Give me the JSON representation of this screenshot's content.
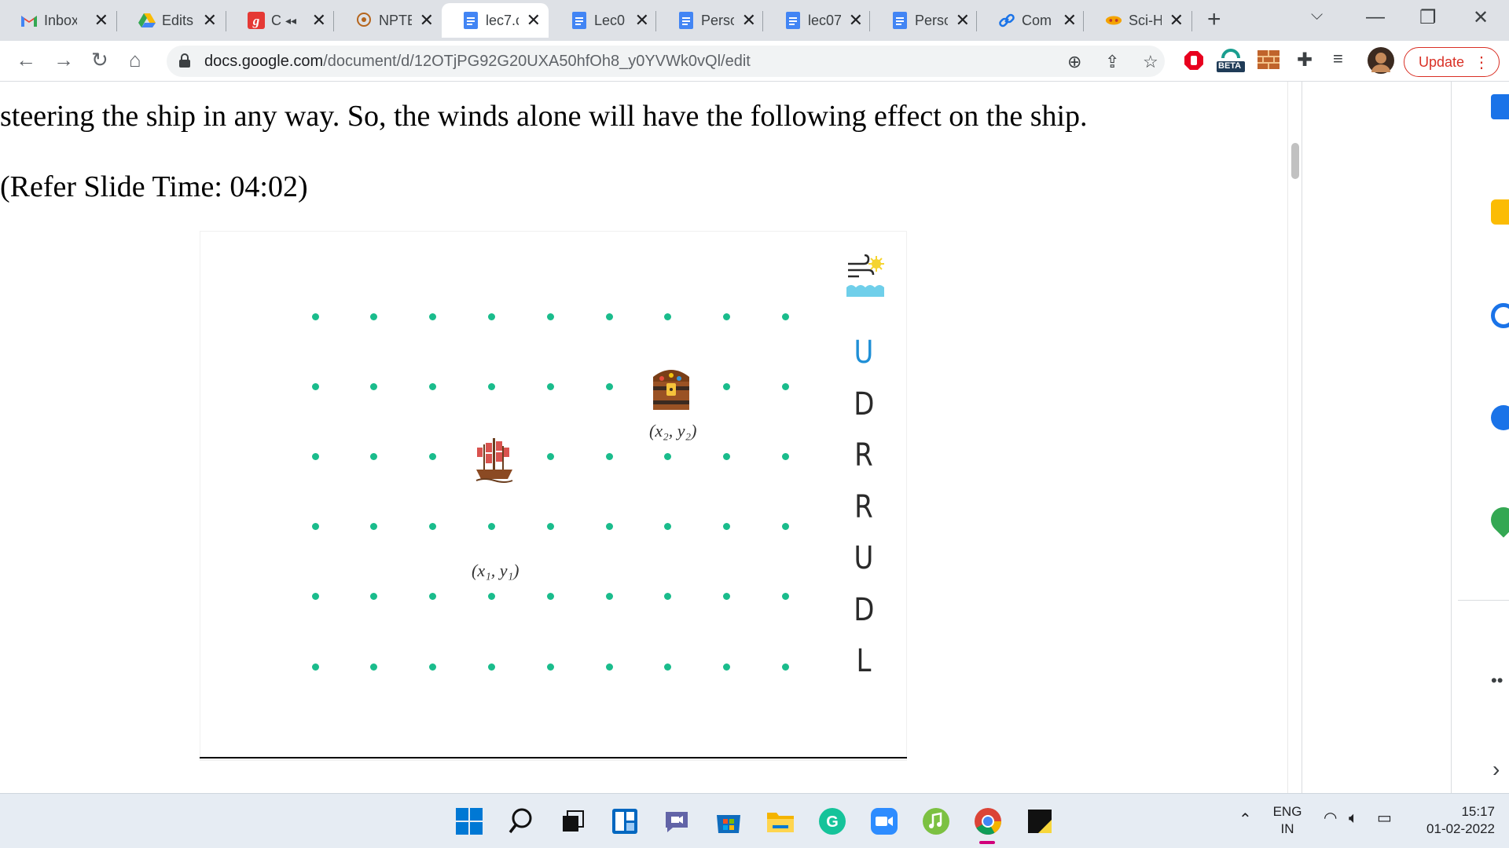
{
  "browser": {
    "tabs": [
      {
        "title": "Inbox",
        "icon": "gmail-icon"
      },
      {
        "title": "Edits",
        "icon": "google-drive-icon"
      },
      {
        "title": "C",
        "icon": "grammarly-icon"
      },
      {
        "title": "NPTE",
        "icon": "nptel-icon"
      },
      {
        "title": "lec7.c",
        "icon": "google-docs-icon"
      },
      {
        "title": "Lec0",
        "icon": "google-docs-icon"
      },
      {
        "title": "Perso",
        "icon": "google-docs-icon"
      },
      {
        "title": "lec07",
        "icon": "google-docs-icon"
      },
      {
        "title": "Perso",
        "icon": "google-docs-icon"
      },
      {
        "title": "Com",
        "icon": "link-icon"
      },
      {
        "title": "Sci-H",
        "icon": "scihub-icon"
      }
    ],
    "active_tab_index": 4,
    "url_host": "docs.google.com",
    "url_path": "/document/d/12OTjPG92G20UXA50hfOh8_y0YVWk0vQl/edit",
    "beta_label": "BETA",
    "update_label": "Update"
  },
  "document": {
    "line1": "steering the ship in any way. So, the winds alone will have the following effect on the ship.",
    "line2": "(Refer Slide Time: 04:02)"
  },
  "slide": {
    "grid_rows": 6,
    "grid_cols": 9,
    "ship_label": "(x₁, y₁)",
    "treasure_label": "(x₂, y₂)",
    "ship_icon": "ship-icon",
    "treasure_icon": "treasure-chest-icon",
    "wind_icon": "wind-icon",
    "wind_moves": [
      "U",
      "D",
      "R",
      "R",
      "U",
      "D",
      "L"
    ],
    "colors": {
      "dot": "#1abc8c",
      "move_highlight": "#1f8fd6"
    }
  },
  "taskbar": {
    "language_line1": "ENG",
    "language_line2": "IN",
    "time": "15:17",
    "date": "01-02-2022"
  }
}
